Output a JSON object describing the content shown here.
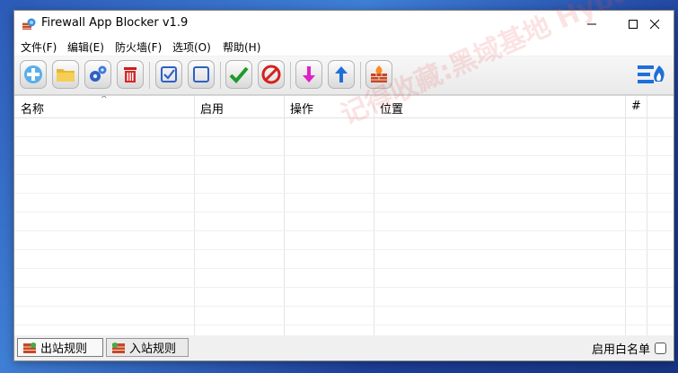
{
  "window": {
    "title": "Firewall App Blocker v1.9"
  },
  "menu": [
    {
      "label": "文件(F)"
    },
    {
      "label": "编辑(E)"
    },
    {
      "label": "防火墙(F)"
    },
    {
      "label": "选项(O)"
    },
    {
      "label": "帮助(H)"
    }
  ],
  "toolbar": {
    "icons": [
      "add-icon",
      "folder-icon",
      "gears-icon",
      "trash-icon",
      "check-box-icon",
      "empty-box-icon",
      "green-check-icon",
      "block-icon",
      "down-arrow-icon",
      "up-arrow-icon",
      "firewall-icon",
      "brand-logo-icon"
    ]
  },
  "table": {
    "columns": [
      {
        "label": "名称"
      },
      {
        "label": "启用"
      },
      {
        "label": "操作"
      },
      {
        "label": "位置"
      },
      {
        "label": "#"
      }
    ],
    "rows": []
  },
  "watermark": "记得收藏:黑域基地 Hybase.com",
  "status": {
    "tabs": [
      {
        "label": "出站规则",
        "active": true
      },
      {
        "label": "入站规则",
        "active": false
      }
    ],
    "whitelist_label": "启用白名单",
    "whitelist_checked": false
  },
  "colors": {
    "accent": "#1e6fd9",
    "danger": "#d32020",
    "success": "#1e9a2c"
  }
}
